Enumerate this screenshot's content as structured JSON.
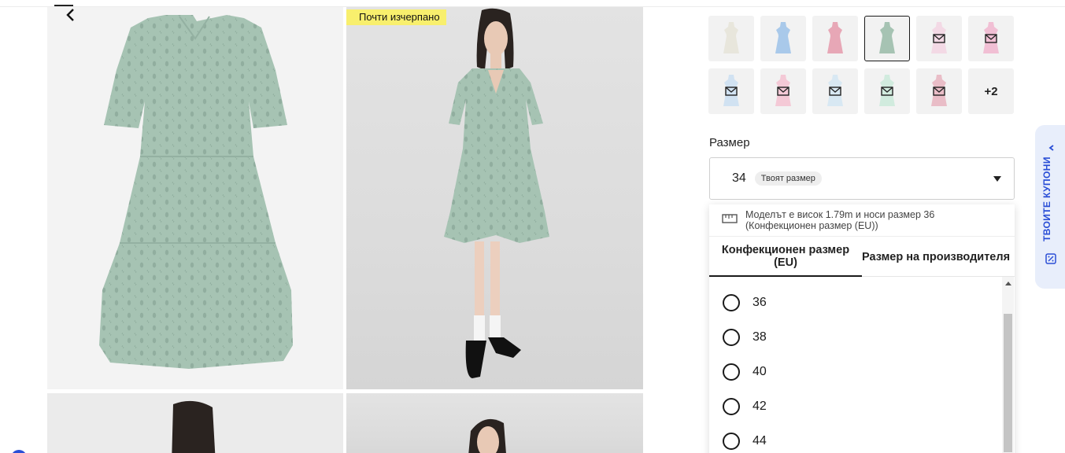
{
  "product": {
    "badge_text": "Почти изчерпано",
    "dress_color": "#a6c3b3"
  },
  "color_swatches": [
    {
      "name": "white",
      "color": "#e8e6dc",
      "type": "image"
    },
    {
      "name": "light-blue",
      "color": "#a9c9ea",
      "type": "image"
    },
    {
      "name": "pink",
      "color": "#e7a7b6",
      "type": "image"
    },
    {
      "name": "mint",
      "color": "#a6c3b3",
      "type": "image",
      "selected": true
    },
    {
      "name": "light-pink",
      "color": "#f3cfe0",
      "type": "mail"
    },
    {
      "name": "pink-2",
      "color": "#f1a9c8",
      "type": "mail"
    },
    {
      "name": "sky-blue",
      "color": "#c3dbf2",
      "type": "mail"
    },
    {
      "name": "rose",
      "color": "#f5b8cb",
      "type": "mail"
    },
    {
      "name": "pale-blue",
      "color": "#cde4f3",
      "type": "mail"
    },
    {
      "name": "mint-2",
      "color": "#c3e8d6",
      "type": "mail"
    },
    {
      "name": "dusty-pink",
      "color": "#e6a7b5",
      "type": "mail"
    },
    {
      "name": "more",
      "type": "more",
      "label": "+2"
    }
  ],
  "size": {
    "label": "Размер",
    "selected_value": "34",
    "selected_badge": "Твоят размер"
  },
  "size_dropdown": {
    "model_info": "Моделът е висок 1.79m и носи размер 36 (Конфекционен размер (EU))",
    "tabs": [
      {
        "label": "Конфекционен размер (EU)",
        "active": true
      },
      {
        "label": "Размер на производителя",
        "active": false
      }
    ],
    "options": [
      "36",
      "38",
      "40",
      "42",
      "44"
    ]
  },
  "coupons": {
    "label": "ТВОИТЕ КУПОНИ",
    "accent": "#2a4ed6"
  }
}
